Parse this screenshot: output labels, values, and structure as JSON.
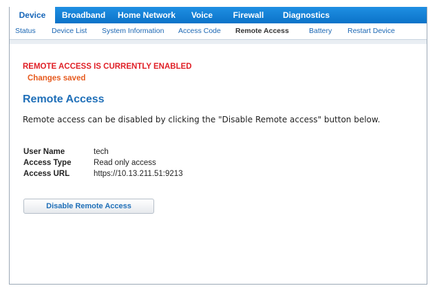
{
  "tabs": [
    {
      "label": "Device",
      "active": true
    },
    {
      "label": "Broadband",
      "active": false
    },
    {
      "label": "Home Network",
      "active": false
    },
    {
      "label": "Voice",
      "active": false
    },
    {
      "label": "Firewall",
      "active": false
    },
    {
      "label": "Diagnostics",
      "active": false
    }
  ],
  "subnav": [
    {
      "label": "Status",
      "active": false
    },
    {
      "label": "Device List",
      "active": false
    },
    {
      "label": "System Information",
      "active": false
    },
    {
      "label": "Access Code",
      "active": false
    },
    {
      "label": "Remote Access",
      "active": true
    },
    {
      "label": "Battery",
      "active": false
    },
    {
      "label": "Restart Device",
      "active": false
    }
  ],
  "status": {
    "alert": "REMOTE ACCESS IS CURRENTLY ENABLED",
    "saved": "Changes saved"
  },
  "section": {
    "title": "Remote Access",
    "description": "Remote access can be disabled by clicking the \"Disable Remote access\" button below."
  },
  "details": [
    {
      "label": "User Name",
      "value": "tech"
    },
    {
      "label": "Access Type",
      "value": "Read only access"
    },
    {
      "label": "Access URL",
      "value": "https://10.13.211.51:9213"
    }
  ],
  "action": {
    "disable_label": "Disable Remote Access"
  },
  "colors": {
    "tab_bar": "#0b73c8",
    "alert": "#e01f26",
    "saved": "#e65a1e",
    "heading": "#1f6fb8",
    "link": "#1a66b3"
  }
}
